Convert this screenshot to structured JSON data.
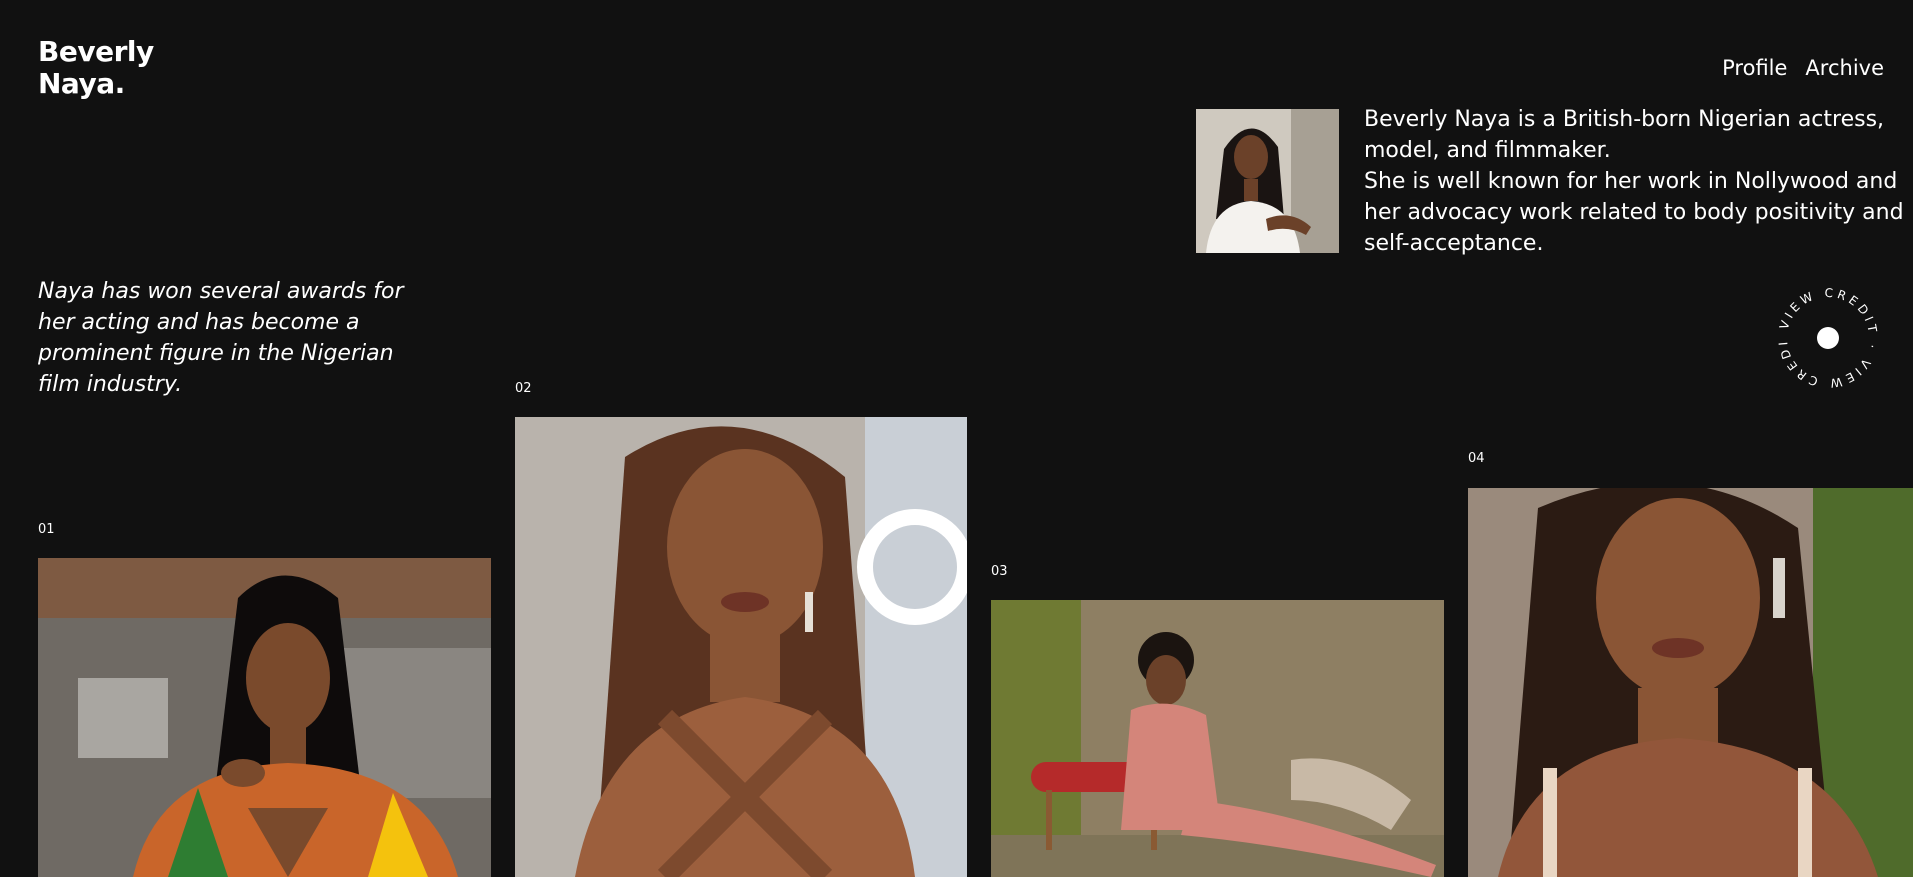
{
  "brand": {
    "line1": "Beverly",
    "line2": "Naya."
  },
  "nav": {
    "profile": "Profile",
    "archive": "Archive"
  },
  "bio": {
    "paragraph1": "Beverly Naya is a British-born Nigerian actress, model, and filmmaker.",
    "paragraph2": "She is well known for her work in Nollywood and her advocacy work related to body positivity and self-acceptance."
  },
  "quote": "Naya has won several awards for her acting and has become a prominent figure in the Nigerian film industry.",
  "credit_badge": {
    "text": "VIEW CREDIT · VIEW CREDIT · "
  },
  "gallery": [
    {
      "number": "01"
    },
    {
      "number": "02"
    },
    {
      "number": "03"
    },
    {
      "number": "04"
    }
  ]
}
